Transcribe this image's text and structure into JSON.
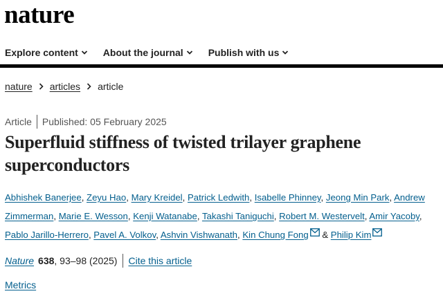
{
  "header": {
    "logo": "nature"
  },
  "nav": {
    "items": [
      {
        "label": "Explore content"
      },
      {
        "label": "About the journal"
      },
      {
        "label": "Publish with us"
      }
    ]
  },
  "breadcrumb": {
    "items": [
      "nature",
      "articles",
      "article"
    ]
  },
  "article": {
    "type": "Article",
    "published": "Published: 05 February 2025",
    "title": "Superfluid stiffness of twisted trilayer graphene superconductors",
    "authors": [
      "Abhishek Banerjee",
      "Zeyu Hao",
      "Mary Kreidel",
      "Patrick Ledwith",
      "Isabelle Phinney",
      "Jeong Min Park",
      "Andrew Zimmerman",
      "Marie E. Wesson",
      "Kenji Watanabe",
      "Takashi Taniguchi",
      "Robert M. Westervelt",
      "Amir Yacoby",
      "Pablo Jarillo-Herrero",
      "Pavel A. Volkov",
      "Ashvin Vishwanath",
      "Kin Chung Fong",
      "Philip Kim"
    ],
    "author_separator": ",",
    "author_conjunction": "&",
    "journal": "Nature",
    "volume": "638",
    "pages_year": ", 93–98 (2025)",
    "cite_label": "Cite this article",
    "metrics_label": "Metrics"
  },
  "colors": {
    "link": "#025e8d",
    "text": "#222222",
    "rule": "#000000"
  }
}
